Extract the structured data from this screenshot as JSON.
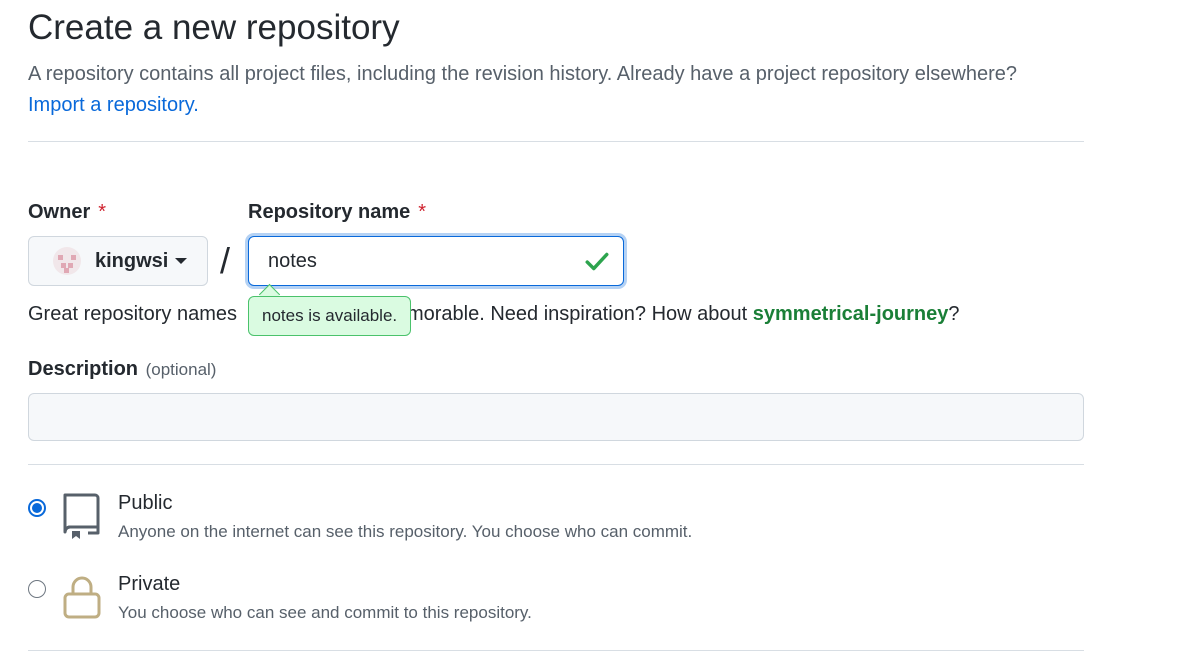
{
  "header": {
    "title": "Create a new repository",
    "subtitle": "A repository contains all project files, including the revision history. Already have a project repository elsewhere?",
    "import_link": "Import a repository."
  },
  "owner": {
    "label": "Owner",
    "required_mark": "*",
    "selected": "kingwsi",
    "avatar_icon": "identicon-avatar",
    "dropdown_icon": "caret-down-icon"
  },
  "separator": "/",
  "repo_name": {
    "label": "Repository name",
    "required_mark": "*",
    "value": "notes",
    "status_icon": "check-icon",
    "availability": "notes is available."
  },
  "hint": {
    "prefix": "Great repository names",
    "middle": "morable. Need inspiration? How about",
    "suggestion": "symmetrical-journey",
    "suffix": "?"
  },
  "description": {
    "label": "Description",
    "optional": "(optional)",
    "value": ""
  },
  "visibility": {
    "options": [
      {
        "title": "Public",
        "desc": "Anyone on the internet can see this repository. You choose who can commit.",
        "selected": true,
        "icon": "repo-icon"
      },
      {
        "title": "Private",
        "desc": "You choose who can see and commit to this repository.",
        "selected": false,
        "icon": "lock-icon"
      }
    ]
  },
  "colors": {
    "link": "#0969da",
    "required": "#cf222e",
    "success": "#1a7f37",
    "tooltip_bg": "#dafbe1",
    "lock_icon": "#bfae83"
  }
}
